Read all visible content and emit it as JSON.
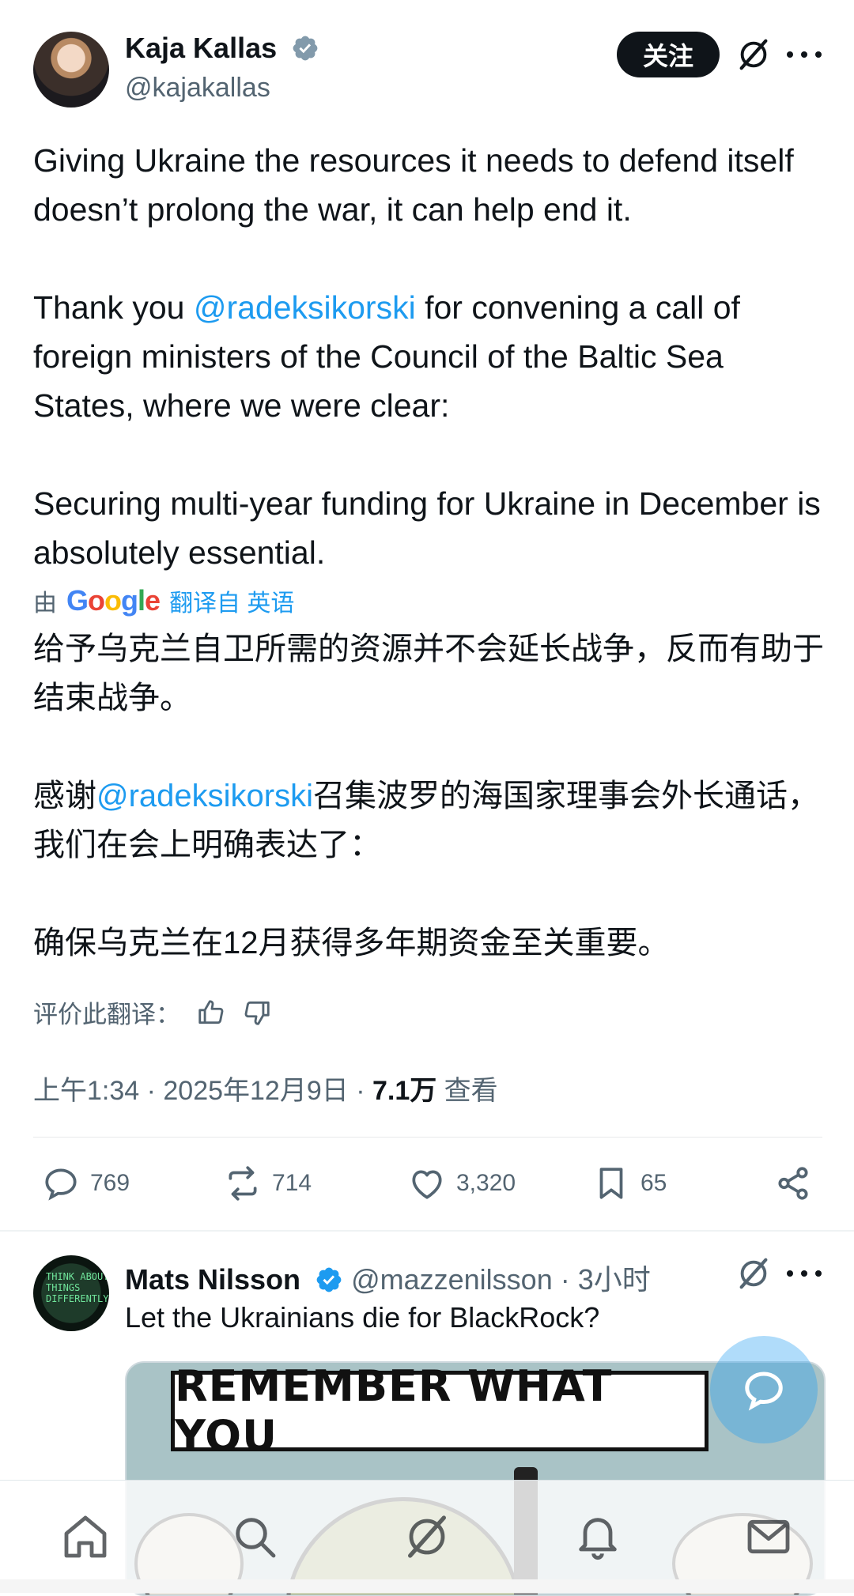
{
  "tweet": {
    "author_name": "Kaja Kallas",
    "author_handle": "@kajakallas",
    "follow_label": "关注",
    "text_p1": "Giving Ukraine the resources it needs to defend itself doesn’t prolong the war, it can help end it.",
    "text_p2_prefix": "Thank you ",
    "mention": "@radeksikorski",
    "text_p2_suffix": " for convening a call of foreign ministers of the Council of the Baltic Sea States, where we were clear:",
    "text_p3": "Securing multi-year funding for Ukraine in December is absolutely essential.",
    "translated_by_prefix": "由",
    "translated_by_brand": "Google",
    "translated_from": "翻译自 英语",
    "trans_p1": "给予乌克兰自卫所需的资源并不会延长战争，反而有助于结束战争。",
    "trans_p2_prefix": "感谢",
    "trans_p2_suffix": "召集波罗的海国家理事会外长通话，我们在会上明确表达了：",
    "trans_p3": "确保乌克兰在12月获得多年期资金至关重要。",
    "rate_label": "评价此翻译：",
    "timestamp": "上午1:34 · 2025年12月9日 · ",
    "views_count": "7.1万",
    "views_label": " 查看",
    "replies": "769",
    "reposts": "714",
    "likes": "3,320",
    "bookmarks": "65"
  },
  "reply": {
    "author_name": "Mats Nilsson",
    "author_handle": "@mazzenilsson",
    "time": " · 3小时",
    "text": "Let the Ukrainians die for BlackRock?",
    "avatar_text": "THINK ABOUT THINGS DIFFERENTLY",
    "image_banner": "REMEMBER WHAT YOU"
  },
  "colors": {
    "accent": "#1d9bf0",
    "text_primary": "#0f1419",
    "text_secondary": "#536471"
  }
}
